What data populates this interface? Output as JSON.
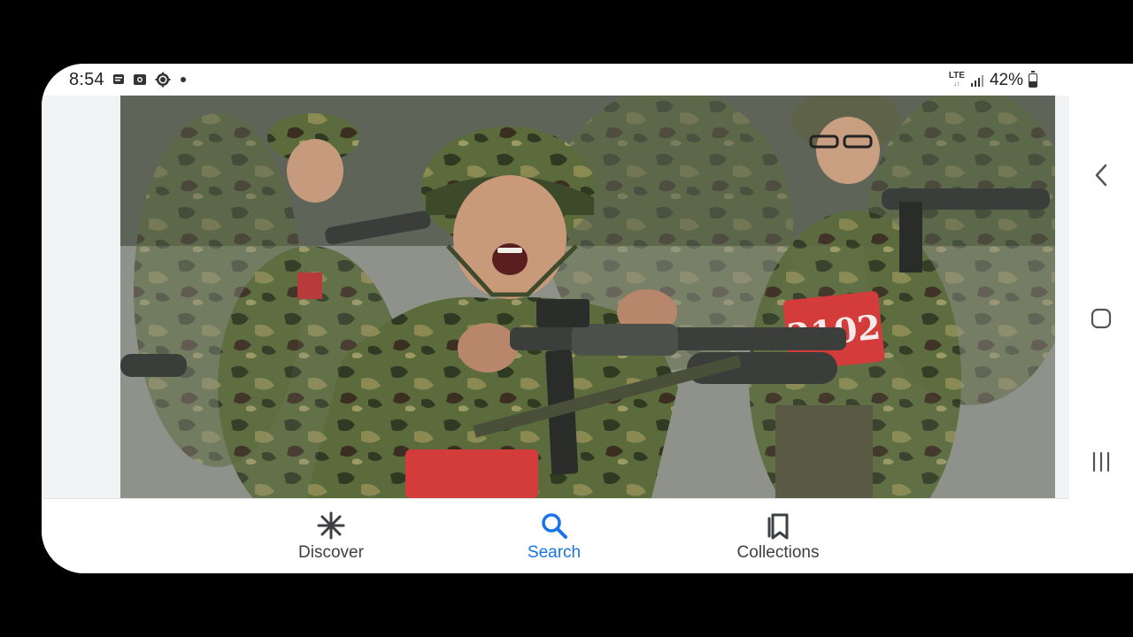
{
  "status_bar": {
    "time": "8:54",
    "left_icons": [
      "message-icon",
      "photo-icon",
      "settings-gear-icon",
      "dot-icon"
    ],
    "network": "LTE",
    "battery_percent": "42%"
  },
  "image": {
    "number_bib": "2102"
  },
  "bottom_nav": {
    "tabs": [
      {
        "label": "Discover",
        "icon": "asterisk-icon",
        "active": false
      },
      {
        "label": "Search",
        "icon": "search-icon",
        "active": true
      },
      {
        "label": "Collections",
        "icon": "bookmarks-icon",
        "active": false
      }
    ]
  },
  "system_nav": [
    "back-icon",
    "home-icon",
    "recents-icon"
  ],
  "colors": {
    "accent": "#1a73e8",
    "text": "#3c4043",
    "background": "#ffffff"
  }
}
